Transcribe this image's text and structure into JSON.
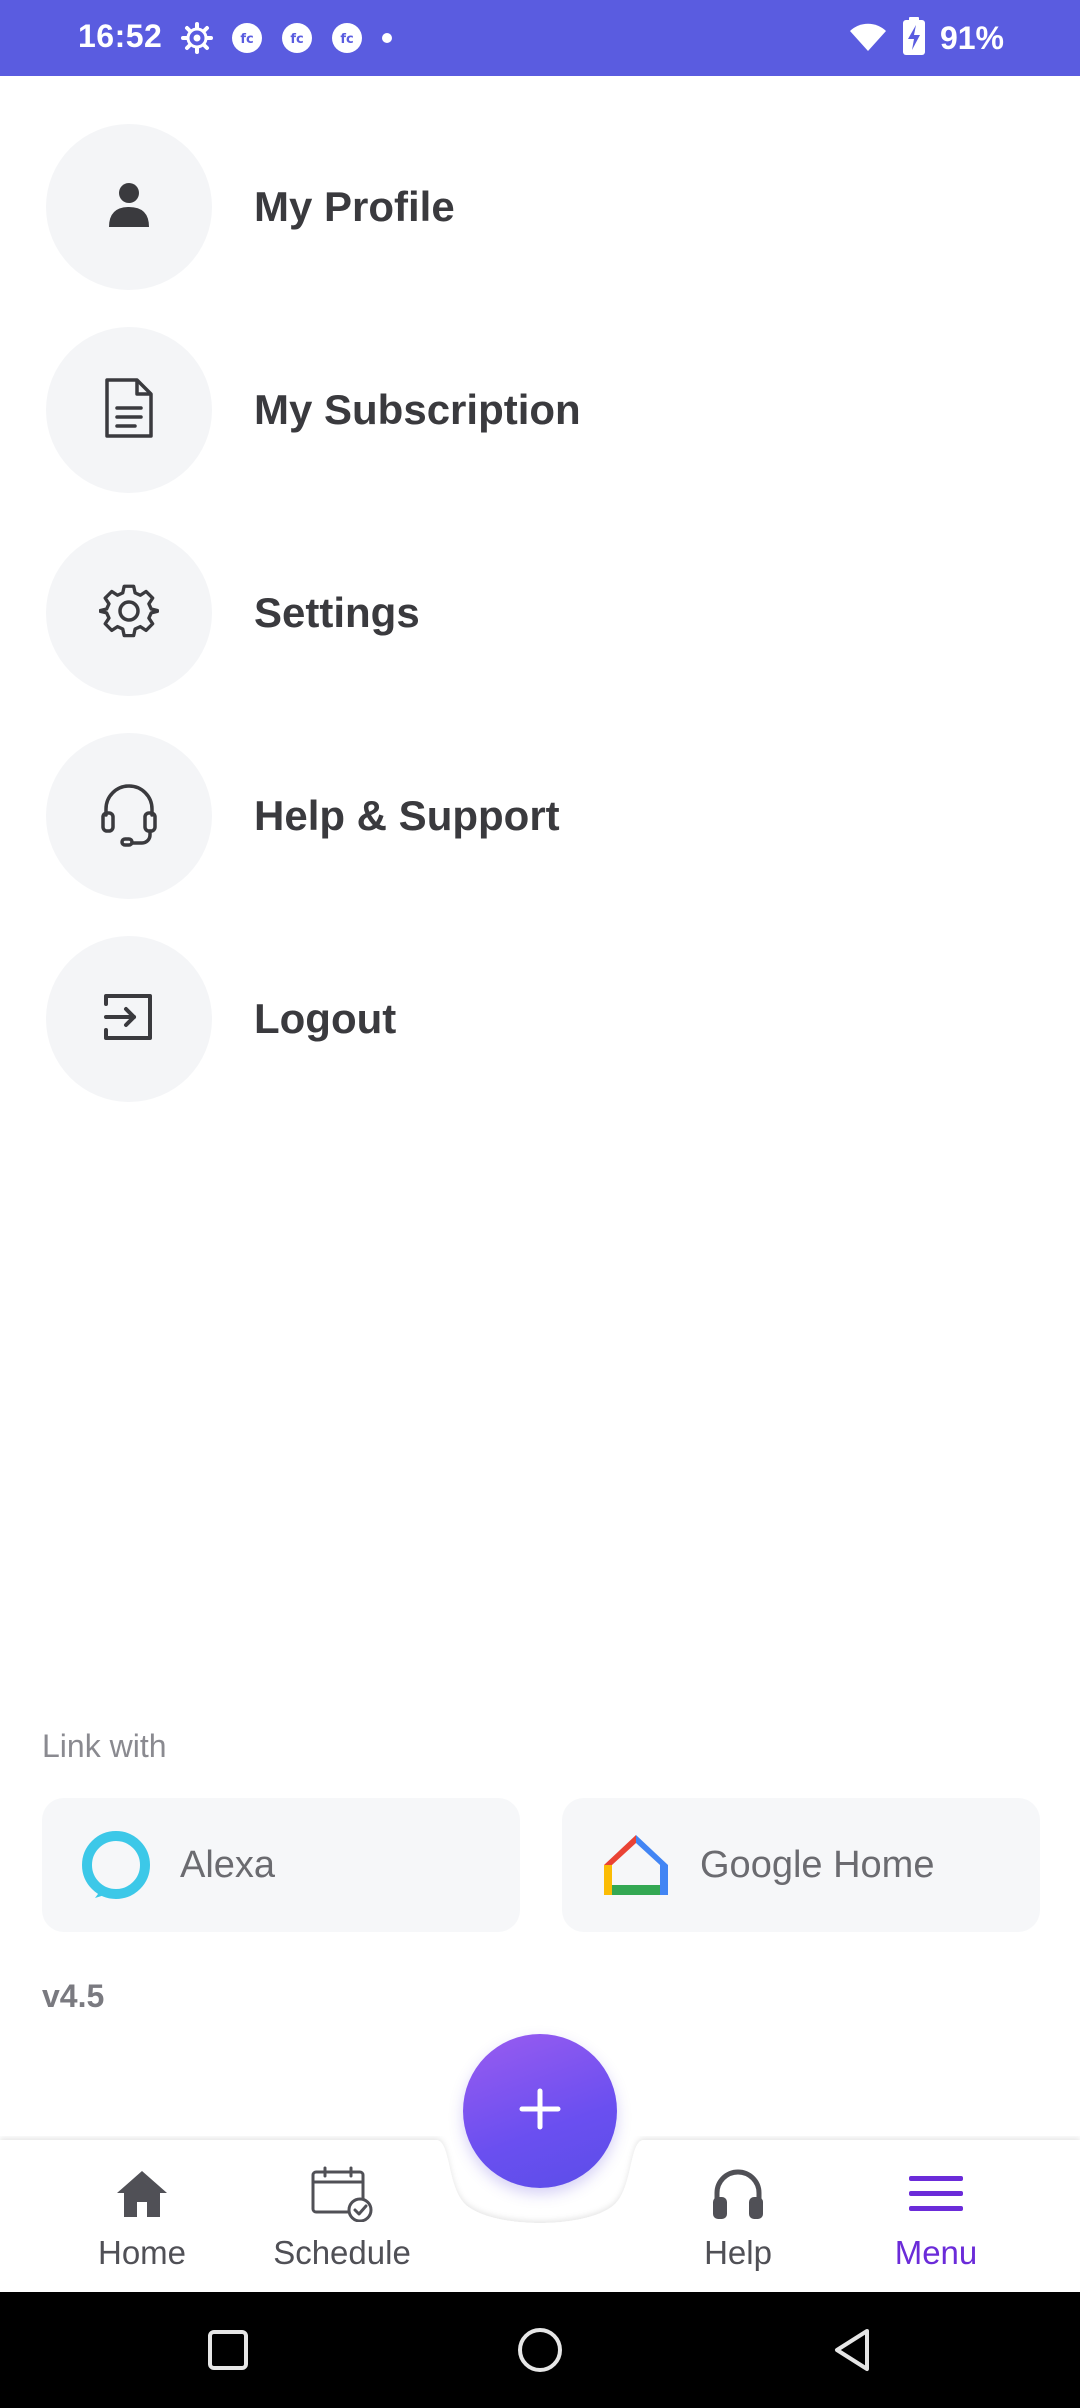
{
  "status_bar": {
    "time": "16:52",
    "battery": "91%",
    "left_icons": [
      "settings-gear-icon",
      "fc-app-icon",
      "fc-app-icon",
      "fc-app-icon",
      "dot-icon"
    ],
    "right_icons": [
      "wifi-icon",
      "battery-charging-icon"
    ]
  },
  "menu": {
    "items": [
      {
        "label": "My Profile",
        "icon": "person-icon"
      },
      {
        "label": "My Subscription",
        "icon": "document-icon"
      },
      {
        "label": "Settings",
        "icon": "gear-icon"
      },
      {
        "label": "Help & Support",
        "icon": "headset-icon"
      },
      {
        "label": "Logout",
        "icon": "logout-icon"
      }
    ]
  },
  "link_with": {
    "title": "Link with",
    "alexa": {
      "label": "Alexa",
      "icon": "alexa-icon"
    },
    "google_home": {
      "label": "Google Home",
      "icon": "google-home-icon"
    }
  },
  "version": "v4.5",
  "bottom_nav": {
    "items": [
      {
        "label": "Home",
        "icon": "home-icon"
      },
      {
        "label": "Schedule",
        "icon": "calendar-check-icon"
      },
      {
        "label": "Help",
        "icon": "headphones-icon"
      },
      {
        "label": "Menu",
        "icon": "hamburger-menu-icon",
        "active": true
      }
    ],
    "fab_icon": "plus-icon"
  },
  "colors": {
    "status_bar": "#5a5ce0",
    "accent": "#6b2bd9",
    "fab_start": "#9a5cf0",
    "fab_end": "#5b4ee8",
    "icon_circle": "#f4f5f7",
    "card_bg": "#f6f7f9"
  },
  "system_nav": [
    "recents-square-icon",
    "home-circle-icon",
    "back-triangle-icon"
  ]
}
